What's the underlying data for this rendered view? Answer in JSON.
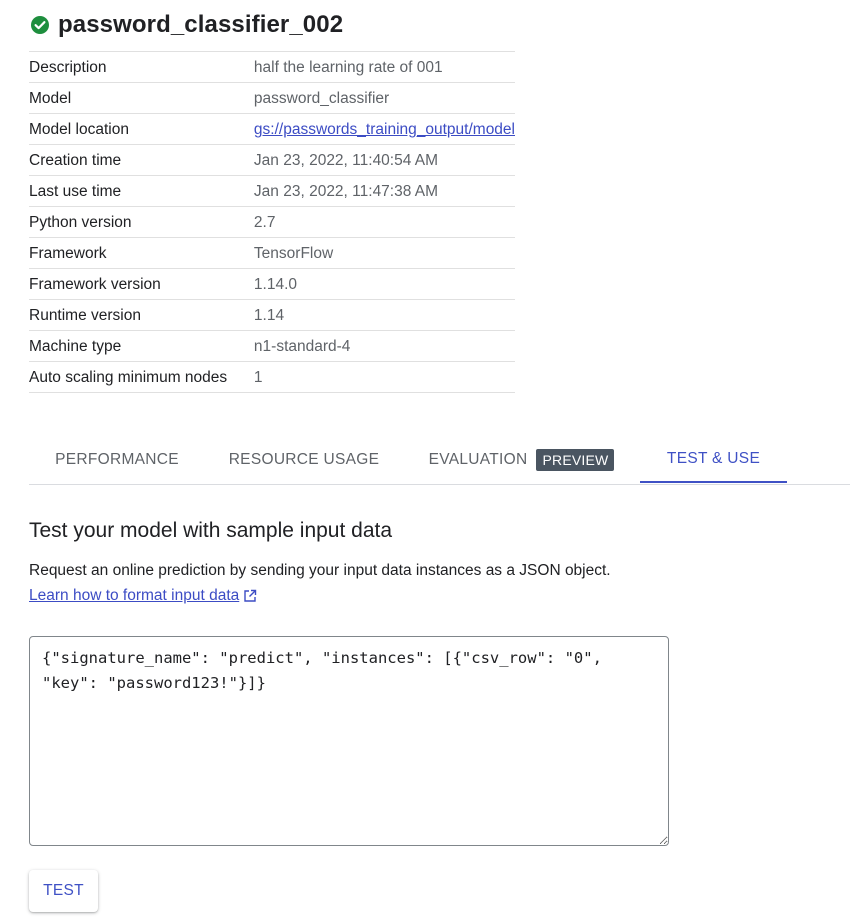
{
  "header": {
    "title": "password_classifier_002",
    "status_icon": "check-circle-icon",
    "status_color": "#1e8e3e"
  },
  "details": [
    {
      "key": "Description",
      "value": "half the learning rate of 001"
    },
    {
      "key": "Model",
      "value": "password_classifier"
    },
    {
      "key": "Model location",
      "value": "gs://passwords_training_output/model",
      "is_link": true
    },
    {
      "key": "Creation time",
      "value": "Jan 23, 2022, 11:40:54 AM"
    },
    {
      "key": "Last use time",
      "value": "Jan 23, 2022, 11:47:38 AM"
    },
    {
      "key": "Python version",
      "value": "2.7"
    },
    {
      "key": "Framework",
      "value": "TensorFlow"
    },
    {
      "key": "Framework version",
      "value": "1.14.0"
    },
    {
      "key": "Runtime version",
      "value": "1.14"
    },
    {
      "key": "Machine type",
      "value": "n1-standard-4"
    },
    {
      "key": "Auto scaling minimum nodes",
      "value": "1"
    }
  ],
  "tabs": [
    {
      "label": "PERFORMANCE"
    },
    {
      "label": "RESOURCE USAGE"
    },
    {
      "label": "EVALUATION",
      "badge": "PREVIEW"
    },
    {
      "label": "TEST & USE",
      "active": true
    }
  ],
  "test_section": {
    "title": "Test your model with sample input data",
    "description": "Request an online prediction by sending your input data instances as a JSON object.",
    "learn_link": "Learn how to format input data",
    "link_icon": "external-link-icon",
    "input_value": "{\"signature_name\": \"predict\", \"instances\": [{\"csv_row\": \"0\", \"key\": \"password123!\"}]}",
    "test_button": "TEST"
  },
  "colors": {
    "accent": "#3f51c5",
    "link": "#3c4cc4",
    "badge_bg": "#4a5561"
  }
}
